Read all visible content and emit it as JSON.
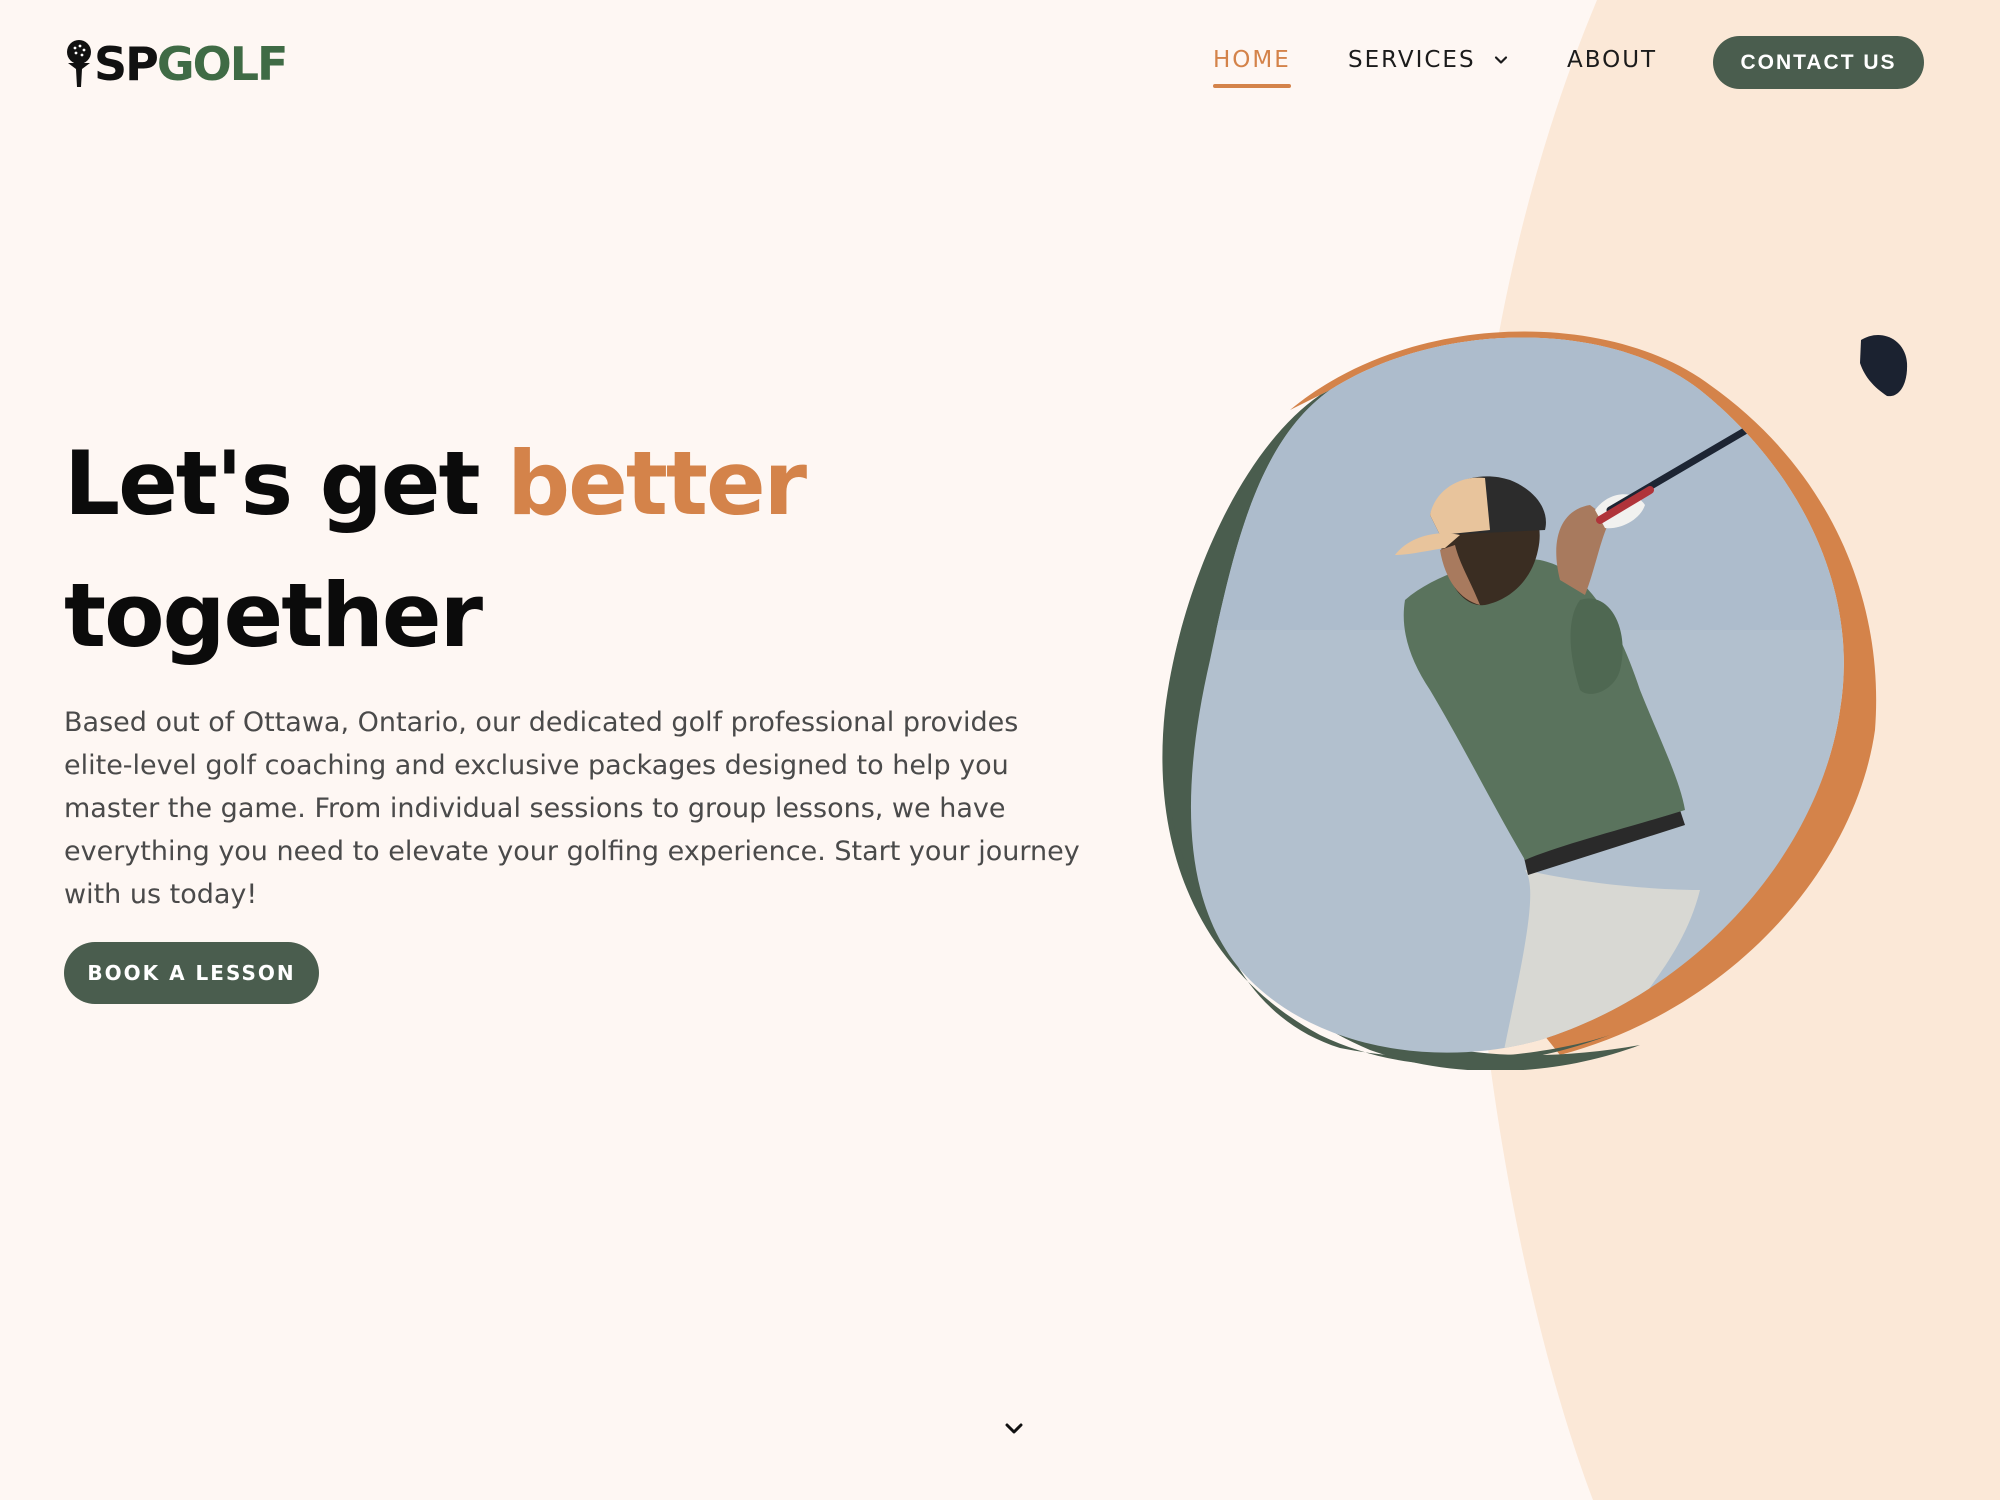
{
  "brand": {
    "logo_part1": "SP",
    "logo_part2": "GOLF",
    "logo_icon": "golf-tee-icon"
  },
  "nav": {
    "home": "HOME",
    "services": "SERVICES",
    "services_icon": "chevron-down-icon",
    "about": "ABOUT",
    "contact": "CONTACT US",
    "active": "home"
  },
  "hero": {
    "title_part1": "Let's get",
    "title_highlight": "better",
    "title_part2": "together",
    "description": "Based out of Ottawa, Ontario, our dedicated golf professional provides elite-level golf coaching and exclusive packages designed to help you master the game. From individual sessions to group lessons, we have everything you need to elevate your golfing experience. Start your journey with us today!",
    "cta": "BOOK A LESSON",
    "image": "golfer-swing-photo"
  },
  "scroll_icon": "chevron-down-icon",
  "colors": {
    "background": "#fef7f3",
    "peach": "#fbe8d7",
    "accent_orange": "#d4834a",
    "forest_green": "#4a5d4e",
    "logo_green": "#3f6b45",
    "sky": "#b2c0ce",
    "text_dark": "#0b0b0b",
    "text_body": "#4a4a4a"
  }
}
